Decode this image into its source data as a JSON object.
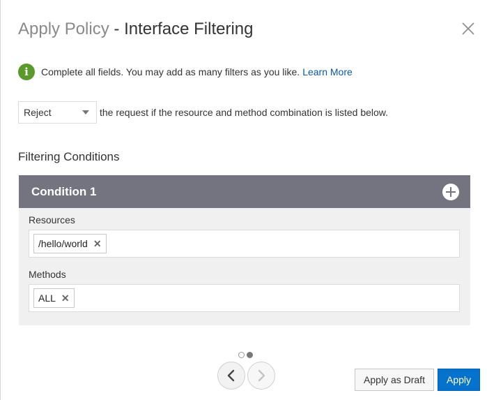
{
  "dialog": {
    "title_lead": "Apply Policy",
    "title_rest": " - Interface Filtering"
  },
  "info": {
    "message": "Complete all fields. You may add as many filters as you like.",
    "link": "Learn More"
  },
  "filter": {
    "action_value": "Reject",
    "description": "the request if the resource and method combination is listed below."
  },
  "conditions": {
    "section_title": "Filtering Conditions",
    "items": [
      {
        "title": "Condition 1",
        "resources_label": "Resources",
        "resources": [
          "/hello/world"
        ],
        "methods_label": "Methods",
        "methods": [
          "ALL"
        ]
      }
    ]
  },
  "pagination": {
    "total": 2,
    "current": 2
  },
  "footer": {
    "draft_label": "Apply as Draft",
    "apply_label": "Apply"
  },
  "icons": {
    "close": "close-icon",
    "info": "info-icon",
    "add": "plus-circle-icon",
    "remove": "remove-x-icon",
    "prev": "chevron-left-icon",
    "next": "chevron-right-icon"
  },
  "colors": {
    "accent": "#0572ce",
    "condition_header": "#737480",
    "info_green": "#5a9a2a",
    "link": "#0a5aa5"
  }
}
